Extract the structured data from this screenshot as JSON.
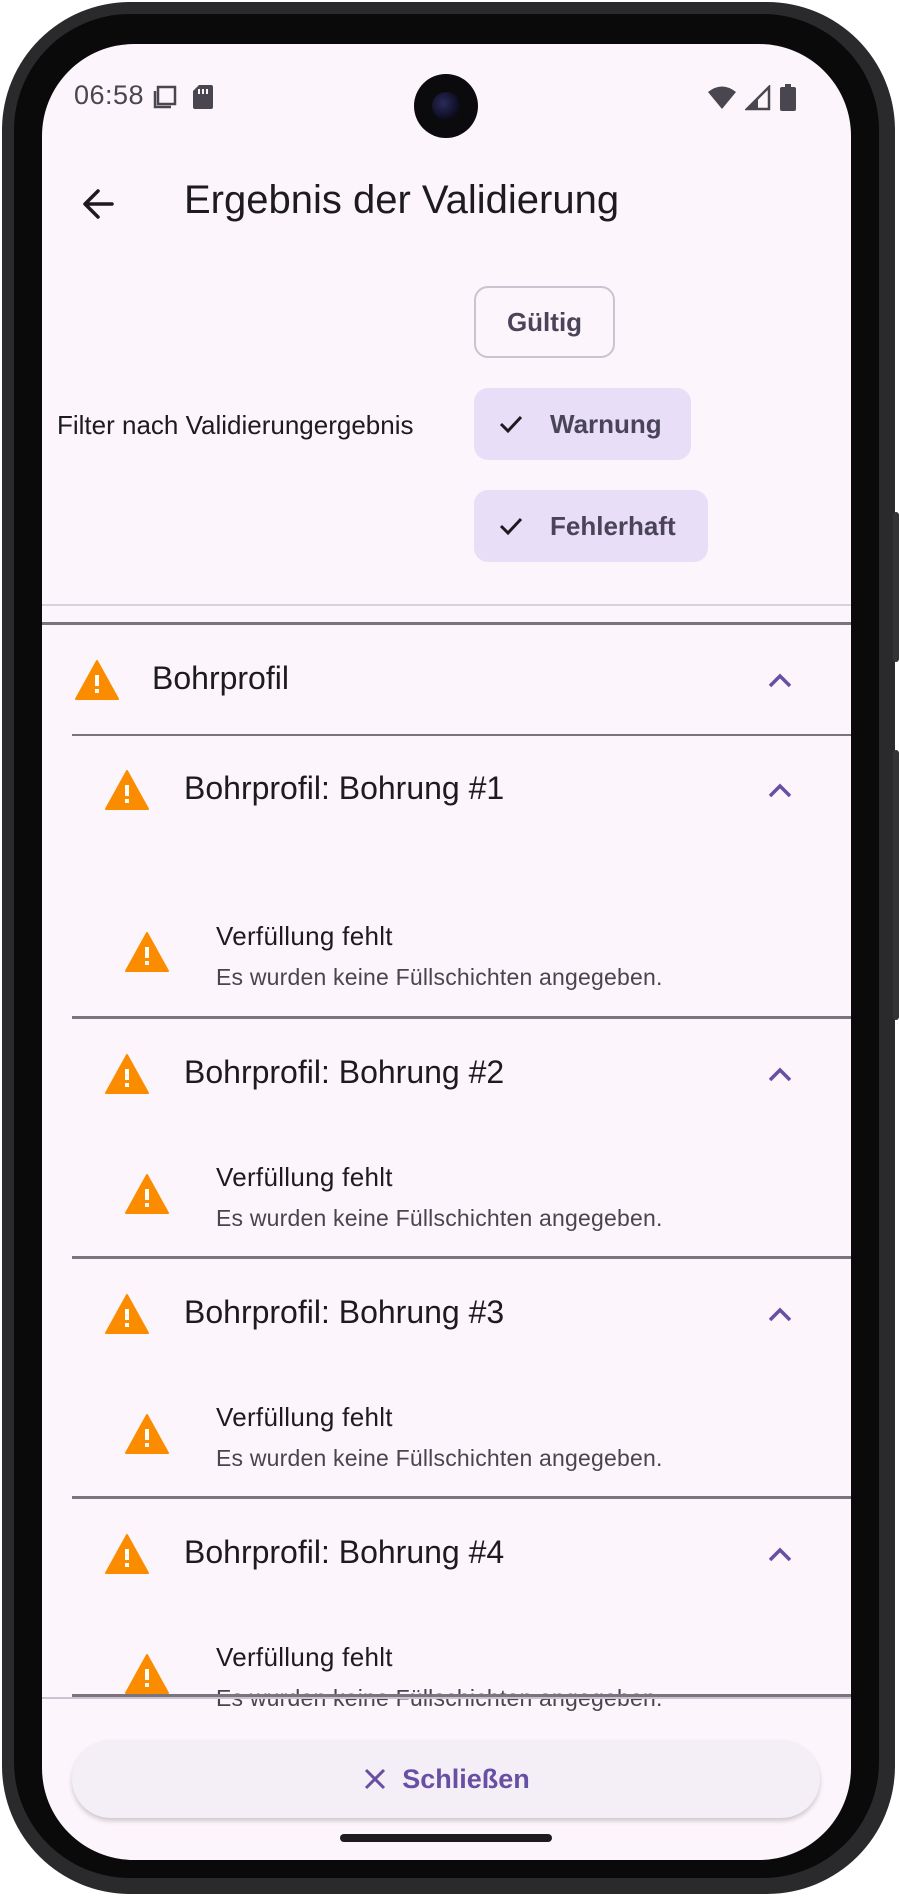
{
  "status": {
    "time": "06:58"
  },
  "app_bar": {
    "title": "Ergebnis der Validierung"
  },
  "filter": {
    "label": "Filter nach Validierungergebnis",
    "chips": [
      {
        "label": "Gültig",
        "selected": false
      },
      {
        "label": "Warnung",
        "selected": true
      },
      {
        "label": "Fehlerhaft",
        "selected": true
      }
    ]
  },
  "results": {
    "group_title": "Bohrprofil",
    "subgroups": [
      {
        "title": "Bohrprofil: Bohrung #1",
        "item_title": "Verfüllung fehlt",
        "item_subtitle": "Es wurden keine Füllschichten angegeben."
      },
      {
        "title": "Bohrprofil: Bohrung #2",
        "item_title": "Verfüllung fehlt",
        "item_subtitle": "Es wurden keine Füllschichten angegeben."
      },
      {
        "title": "Bohrprofil: Bohrung #3",
        "item_title": "Verfüllung fehlt",
        "item_subtitle": "Es wurden keine Füllschichten angegeben."
      },
      {
        "title": "Bohrprofil: Bohrung #4",
        "item_title": "Verfüllung fehlt",
        "item_subtitle": "Es wurden keine Füllschichten angegeben."
      }
    ]
  },
  "footer": {
    "close_label": "Schließen"
  },
  "colors": {
    "background": "#fcf5fb",
    "warning": "#fb8c00",
    "accent": "#6750a4",
    "chip_selected": "#e8def8"
  },
  "icons": [
    "back-arrow-icon",
    "check-icon",
    "warning-icon",
    "chevron-up-icon",
    "close-icon",
    "wifi-icon",
    "signal-icon",
    "battery-icon",
    "sim-icon",
    "screenshot-icon"
  ]
}
